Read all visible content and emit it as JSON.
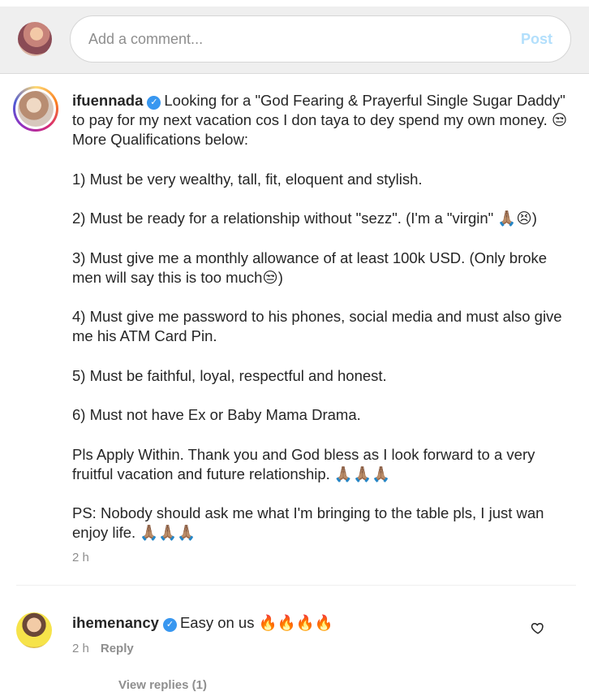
{
  "composer": {
    "placeholder": "Add a comment...",
    "post_label": "Post"
  },
  "post": {
    "username": "ifuennada",
    "paragraphs": [
      "Looking for a \"God Fearing & Prayerful Single Sugar Daddy\" to pay for my next vacation cos I don taya to dey spend my own money. 😒 More Qualifications below:",
      "1) Must be very wealthy, tall, fit, eloquent and stylish.",
      "2) Must be ready for a relationship without \"sezz\". (I'm a \"virgin\" 🙏🏽😣)",
      "3) Must give me a monthly allowance of at least 100k USD. (Only broke men will say this is too much😒)",
      "4) Must give me password to his phones, social media and must also give me his ATM Card Pin.",
      "5) Must be faithful, loyal, respectful and honest.",
      "6) Must not have Ex or Baby Mama Drama.",
      "Pls Apply Within. Thank you and God bless as I look forward to a very fruitful vacation and future relationship. 🙏🏽🙏🏽🙏🏽",
      "PS: Nobody should ask me what I'm bringing to the table pls, I just wan enjoy life. 🙏🏽🙏🏽🙏🏽"
    ],
    "time": "2 h",
    "verified_icon": "verified-badge-icon"
  },
  "reply": {
    "username": "ihemenancy",
    "text": "Easy on us 🔥🔥🔥🔥",
    "time": "2 h",
    "reply_label": "Reply",
    "like_icon": "heart-icon",
    "view_replies": "View replies (1)"
  }
}
